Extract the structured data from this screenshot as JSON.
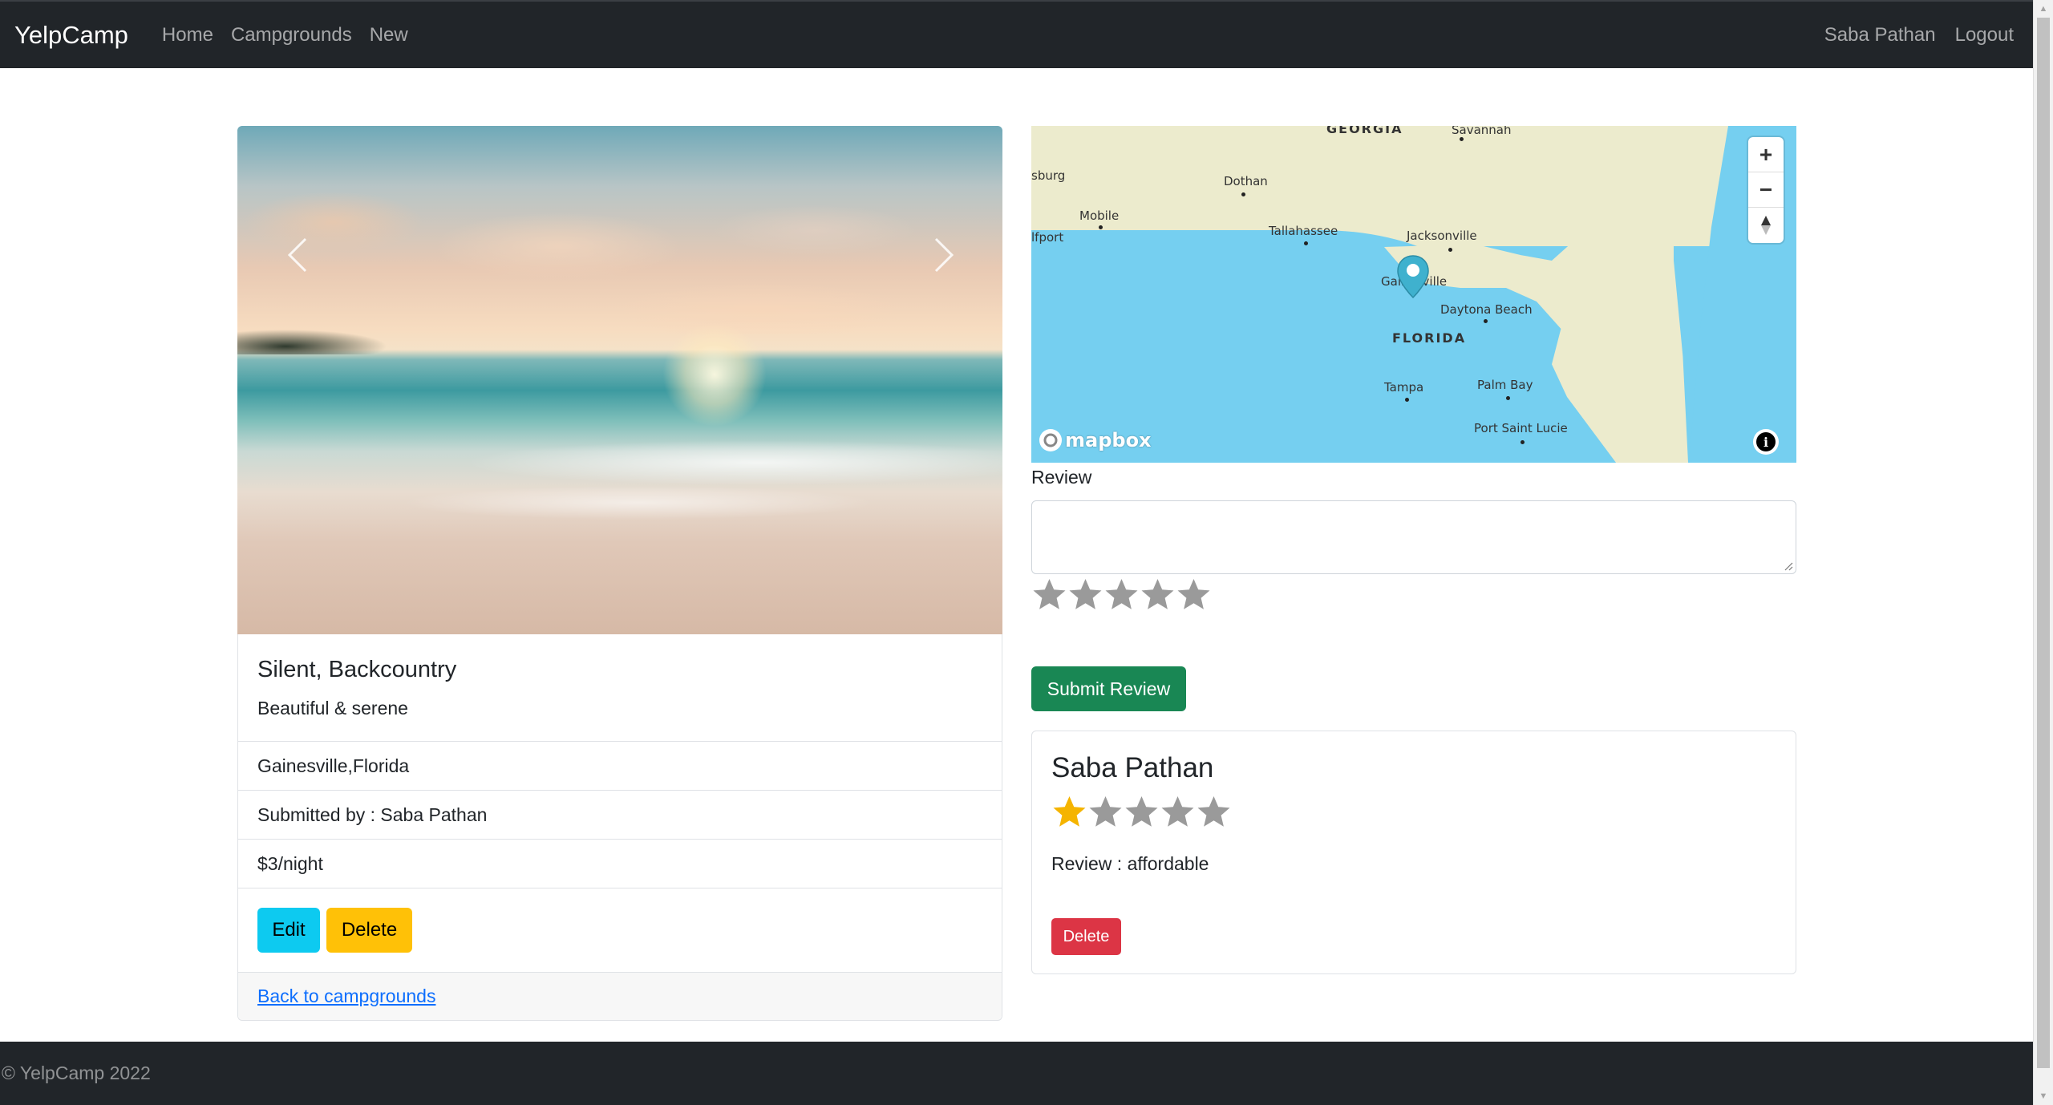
{
  "navbar": {
    "brand": "YelpCamp",
    "links": [
      "Home",
      "Campgrounds",
      "New"
    ],
    "user": "Saba Pathan",
    "logout": "Logout"
  },
  "campground": {
    "title": "Silent, Backcountry",
    "description": "Beautiful & serene",
    "location": "Gainesville,Florida",
    "submitted_by": "Submitted by : Saba Pathan",
    "price": "$3/night",
    "edit_label": "Edit",
    "delete_label": "Delete",
    "back_link": "Back to campgrounds"
  },
  "map": {
    "labels": {
      "georgia": "GEORGIA",
      "savannah": "Savannah",
      "dothan": "Dothan",
      "mobile": "Mobile",
      "tallahassee": "Tallahassee",
      "jacksonville": "Jacksonville",
      "gainesville": "Gainesville",
      "daytona": "Daytona Beach",
      "florida": "FLORIDA",
      "tampa": "Tampa",
      "palm_bay": "Palm Bay",
      "port_st_lucie": "Port Saint Lucie",
      "sburg": "sburg",
      "gulfport": "lfport"
    },
    "logo_text": "mapbox",
    "info_symbol": "i",
    "zoom_in": "+",
    "zoom_out": "−"
  },
  "review_form": {
    "label": "Review",
    "textarea_value": "",
    "submit_label": "Submit Review",
    "rating": 0
  },
  "reviews": [
    {
      "author": "Saba Pathan",
      "rating": 1,
      "body": "Review : affordable",
      "delete_label": "Delete"
    }
  ],
  "footer": {
    "text": "© YelpCamp 2022"
  },
  "colors": {
    "navbar_bg": "#212529",
    "edit_btn": "#0dcaf0",
    "delete_btn": "#ffc107",
    "submit_btn": "#198754",
    "danger_btn": "#dc3545",
    "star_filled": "#f5b400",
    "star_empty": "#9a9a9a",
    "map_water": "#75cff0",
    "map_land": "#ecebcd",
    "pin": "#3fb1ce"
  }
}
